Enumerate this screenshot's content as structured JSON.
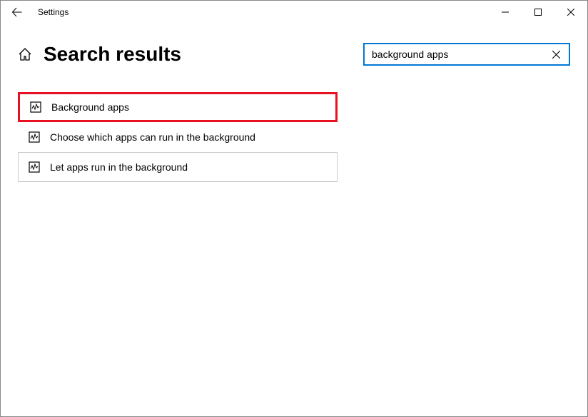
{
  "window": {
    "title": "Settings"
  },
  "header": {
    "page_title": "Search results"
  },
  "search": {
    "value": "background apps"
  },
  "results": {
    "items": [
      {
        "label": "Background apps",
        "highlighted": true
      },
      {
        "label": "Choose which apps can run in the background",
        "highlighted": false
      },
      {
        "label": "Let apps run in the background",
        "highlighted": false
      }
    ]
  }
}
